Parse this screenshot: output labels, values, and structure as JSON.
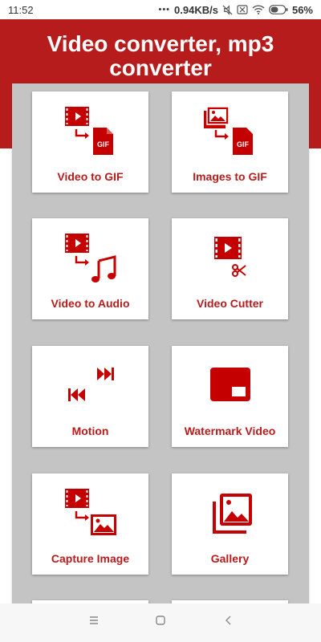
{
  "status_bar": {
    "time": "11:52",
    "network_speed": "0.94KB/s",
    "battery": "56%",
    "icons": [
      "more-dots-icon",
      "mute-icon",
      "sim-off-icon",
      "wifi-icon",
      "battery-icon"
    ]
  },
  "header": {
    "title_line1": "Video converter, mp3",
    "title_line2": "converter",
    "color": "#b71c1c"
  },
  "cards": [
    {
      "label": "Video to GIF",
      "icon": "video-to-gif-icon"
    },
    {
      "label": "Images to GIF",
      "icon": "images-to-gif-icon"
    },
    {
      "label": "Video to Audio",
      "icon": "video-to-audio-icon"
    },
    {
      "label": "Video Cutter",
      "icon": "video-cutter-icon"
    },
    {
      "label": "Motion",
      "icon": "motion-icon"
    },
    {
      "label": "Watermark Video",
      "icon": "watermark-icon"
    },
    {
      "label": "Capture Image",
      "icon": "capture-image-icon"
    },
    {
      "label": "Gallery",
      "icon": "gallery-icon"
    }
  ],
  "nav_bar": {
    "buttons": [
      "menu-icon",
      "home-icon",
      "back-icon"
    ]
  },
  "colors": {
    "accent": "#b71c1c",
    "panel": "#c4c4c4",
    "card": "#ffffff"
  }
}
